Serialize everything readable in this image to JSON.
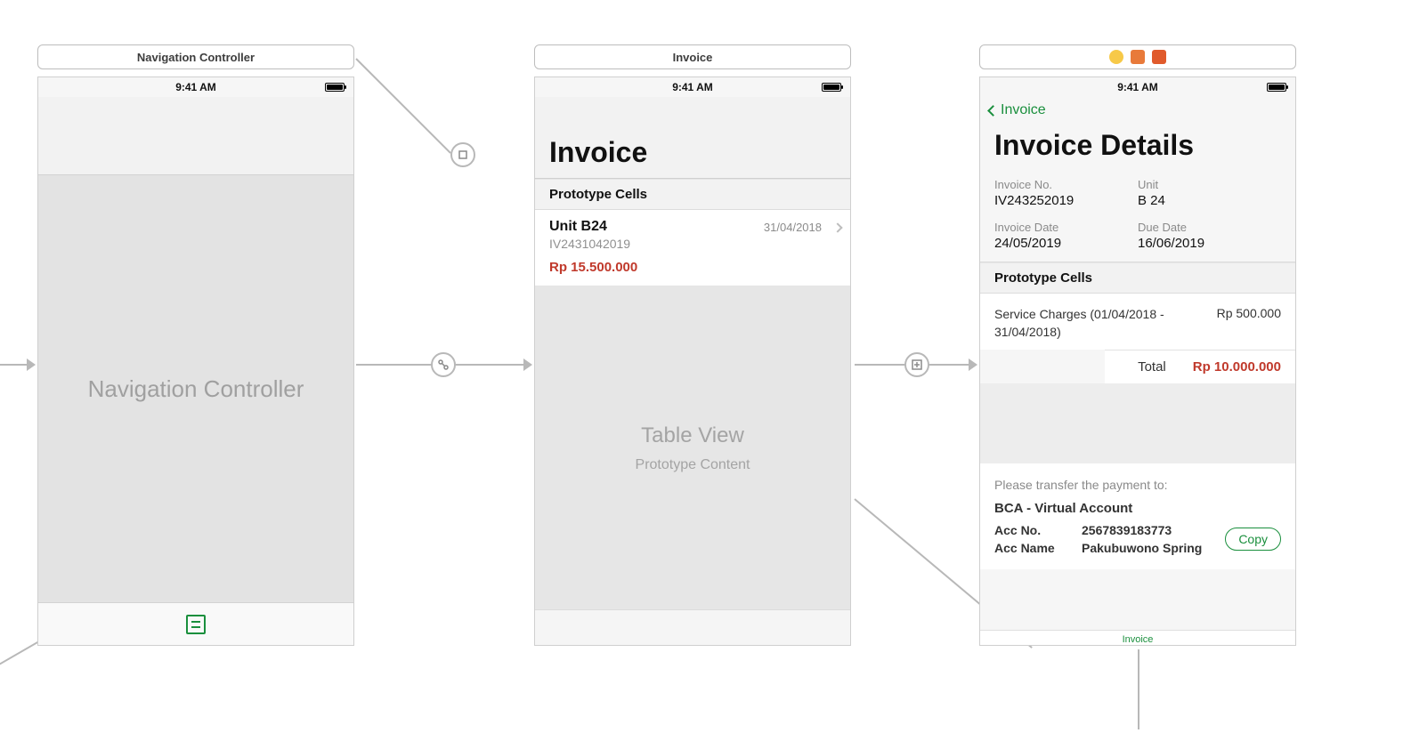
{
  "status": {
    "time": "9:41 AM"
  },
  "scene1": {
    "title": "Navigation Controller",
    "body_label": "Navigation Controller"
  },
  "scene2": {
    "title": "Invoice",
    "large_title": "Invoice",
    "section_header": "Prototype Cells",
    "cell": {
      "unit": "Unit B24",
      "date": "31/04/2018",
      "code": "IV2431042019",
      "amount": "Rp 15.500.000"
    },
    "placeholder_title": "Table View",
    "placeholder_subtitle": "Prototype Content"
  },
  "scene3": {
    "back_label": "Invoice",
    "large_title": "Invoice Details",
    "fields": {
      "invoice_no_label": "Invoice No.",
      "invoice_no": "IV243252019",
      "unit_label": "Unit",
      "unit": "B 24",
      "invoice_date_label": "Invoice Date",
      "invoice_date": "24/05/2019",
      "due_date_label": "Due Date",
      "due_date": "16/06/2019"
    },
    "section_header": "Prototype Cells",
    "line_item": {
      "desc": "Service Charges (01/04/2018 - 31/04/2018)",
      "amount": "Rp 500.000"
    },
    "total_label": "Total",
    "total_amount": "Rp 10.000.000",
    "payment": {
      "hint": "Please transfer the payment to:",
      "bank": "BCA - Virtual Account",
      "acc_no_label": "Acc No.",
      "acc_no": "2567839183773",
      "acc_name_label": "Acc Name",
      "acc_name": "Pakubuwono Spring",
      "copy": "Copy"
    },
    "bottom_tab": "Invoice"
  }
}
